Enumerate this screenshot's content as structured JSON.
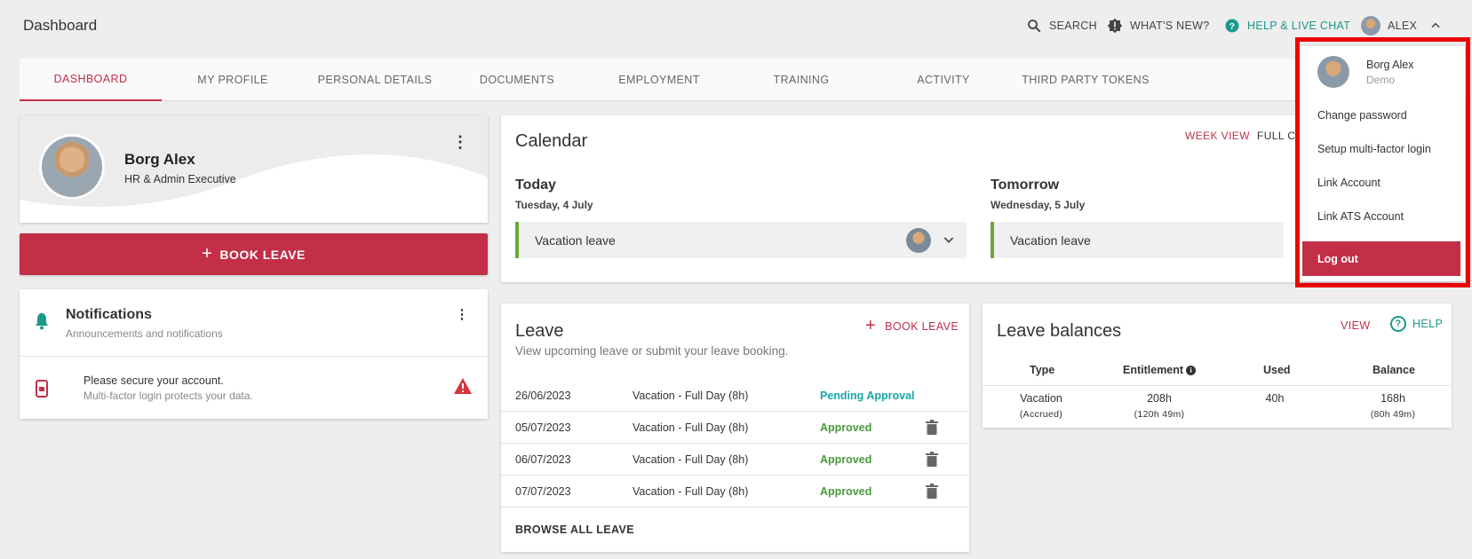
{
  "header": {
    "title": "Dashboard",
    "search_label": "SEARCH",
    "whats_new_label": "WHAT'S NEW?",
    "help_label": "HELP & LIVE CHAT",
    "user_label": "ALEX"
  },
  "tabs": [
    {
      "label": "DASHBOARD"
    },
    {
      "label": "MY PROFILE"
    },
    {
      "label": "PERSONAL DETAILS"
    },
    {
      "label": "DOCUMENTS"
    },
    {
      "label": "EMPLOYMENT"
    },
    {
      "label": "TRAINING"
    },
    {
      "label": "ACTIVITY"
    },
    {
      "label": "THIRD PARTY TOKENS"
    }
  ],
  "profile": {
    "name": "Borg Alex",
    "role": "HR & Admin Executive"
  },
  "book_leave": {
    "label": "BOOK LEAVE"
  },
  "notifications": {
    "title": "Notifications",
    "subtitle": "Announcements and notifications",
    "message": "Please secure your account.",
    "message_sub": "Multi-factor login protects your data."
  },
  "calendar": {
    "title": "Calendar",
    "week_view": "WEEK VIEW",
    "full_calendar": "FULL C",
    "today": {
      "label": "Today",
      "date": "Tuesday, 4 July",
      "event": "Vacation leave"
    },
    "tomorrow": {
      "label": "Tomorrow",
      "date": "Wednesday, 5 July",
      "event": "Vacation leave"
    }
  },
  "leave": {
    "title": "Leave",
    "subtitle": "View upcoming leave or submit your leave booking.",
    "book_label": "BOOK LEAVE",
    "rows": [
      {
        "date": "26/06/2023",
        "type": "Vacation - Full Day (8h)",
        "status": "Pending Approval"
      },
      {
        "date": "05/07/2023",
        "type": "Vacation - Full Day (8h)",
        "status": "Approved"
      },
      {
        "date": "06/07/2023",
        "type": "Vacation - Full Day (8h)",
        "status": "Approved"
      },
      {
        "date": "07/07/2023",
        "type": "Vacation - Full Day (8h)",
        "status": "Approved"
      }
    ],
    "browse_all": "BROWSE ALL LEAVE"
  },
  "balances": {
    "title": "Leave balances",
    "view_label": "VIEW",
    "help_label": "HELP",
    "headers": [
      "Type",
      "Entitlement",
      "Used",
      "Balance"
    ],
    "row": {
      "type": "Vacation",
      "type_sub": "(Accrued)",
      "entitlement": "208h",
      "entitlement_sub": "(120h 49m)",
      "used": "40h",
      "balance": "168h",
      "balance_sub": "(80h 49m)"
    }
  },
  "user_menu": {
    "name": "Borg Alex",
    "role": "Demo",
    "items": [
      "Change password",
      "Setup multi-factor login",
      "Link Account",
      "Link ATS Account"
    ],
    "logout": "Log out"
  },
  "colors": {
    "accent": "#c22f47",
    "approved": "#4a9a3a",
    "pending": "#1aa5a5",
    "help": "#1a9a8a",
    "highlight": "#ee0000"
  }
}
